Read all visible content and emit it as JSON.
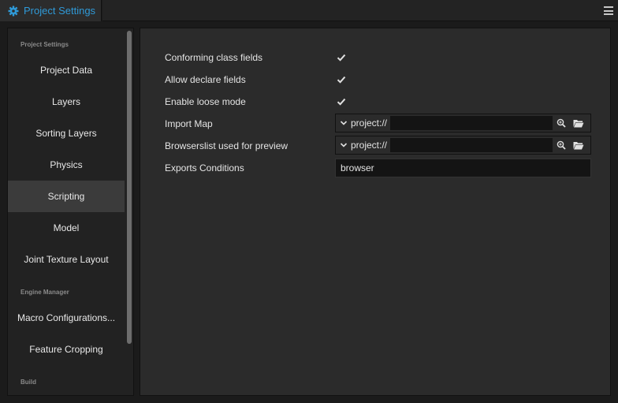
{
  "tab": {
    "title": "Project Settings",
    "icon": "gear-icon",
    "accent": "#2f9ad8"
  },
  "sidebar": {
    "sections": [
      "Project Settings",
      "Engine Manager",
      "Build"
    ],
    "items": [
      {
        "label": "Project Data"
      },
      {
        "label": "Layers"
      },
      {
        "label": "Sorting Layers"
      },
      {
        "label": "Physics"
      },
      {
        "label": "Scripting",
        "active": true
      },
      {
        "label": "Model"
      },
      {
        "label": "Joint Texture Layout"
      },
      {
        "label": "Macro Configurations..."
      },
      {
        "label": "Feature Cropping"
      }
    ]
  },
  "main": {
    "rows": [
      {
        "label": "Conforming class fields",
        "checked": true
      },
      {
        "label": "Allow declare fields",
        "checked": true
      },
      {
        "label": "Enable loose mode",
        "checked": true
      },
      {
        "label": "Import Map",
        "protocol": "project://",
        "value": "",
        "icons": [
          "search-icon",
          "folder-open-icon"
        ]
      },
      {
        "label": "Browserslist used for preview",
        "protocol": "project://",
        "value": "",
        "icons": [
          "search-icon",
          "folder-open-icon"
        ]
      },
      {
        "label": "Exports Conditions",
        "value": "browser"
      }
    ]
  }
}
